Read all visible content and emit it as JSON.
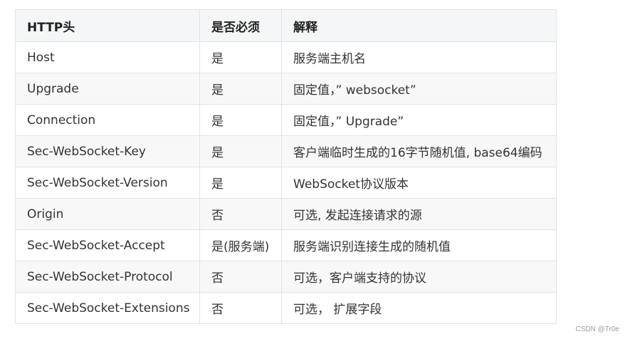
{
  "table": {
    "headers": [
      "HTTP头",
      "是否必须",
      "解释"
    ],
    "rows": [
      [
        "Host",
        "是",
        "服务端主机名"
      ],
      [
        "Upgrade",
        "是",
        "固定值，” websocket”"
      ],
      [
        "Connection",
        "是",
        "固定值，” Upgrade”"
      ],
      [
        "Sec-WebSocket-Key",
        "是",
        "客户端临时生成的16字节随机值, base64编码"
      ],
      [
        "Sec-WebSocket-Version",
        "是",
        "WebSocket协议版本"
      ],
      [
        "Origin",
        "否",
        "可选, 发起连接请求的源"
      ],
      [
        "Sec-WebSocket-Accept",
        "是(服务端)",
        "服务端识别连接生成的随机值"
      ],
      [
        "Sec-WebSocket-Protocol",
        "否",
        "可选，客户端支持的协议"
      ],
      [
        "Sec-WebSocket-Extensions",
        "否",
        "可选， 扩展字段"
      ]
    ]
  },
  "watermark": "CSDN @Tr0e"
}
